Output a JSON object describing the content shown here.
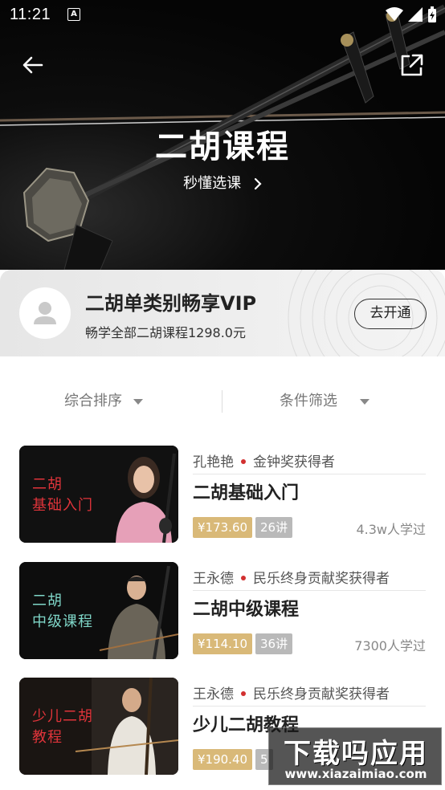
{
  "status_bar": {
    "time": "11:21",
    "a_icon": "A"
  },
  "hero": {
    "title": "二胡课程",
    "subtitle": "秒懂选课"
  },
  "vip": {
    "title": "二胡单类别畅享VIP",
    "description": "畅学全部二胡课程1298.0元",
    "button_label": "去开通"
  },
  "filters": {
    "sort_label": "综合排序",
    "filter_label": "条件筛选"
  },
  "courses": [
    {
      "thumb_text": "二胡\n基础入门",
      "thumb_color": "#e0343a",
      "teacher": "孔艳艳",
      "award": "金钟奖获得者",
      "title": "二胡基础入门",
      "price": "¥173.60",
      "lessons": "26讲",
      "learners": "4.3w人学过"
    },
    {
      "thumb_text": "二胡\n中级课程",
      "thumb_color": "#7fd6c8",
      "teacher": "王永德",
      "award": "民乐终身贡献奖获得者",
      "title": "二胡中级课程",
      "price": "¥114.10",
      "lessons": "36讲",
      "learners": "7300人学过"
    },
    {
      "thumb_text": "少儿二胡\n教程",
      "thumb_color": "#e0343a",
      "teacher": "王永德",
      "award": "民乐终身贡献奖获得者",
      "title": "少儿二胡教程",
      "price": "¥190.40",
      "lessons": "5",
      "learners": ""
    }
  ],
  "watermark": {
    "big": "下载吗应用",
    "small": "www.xiazaimiao.com"
  },
  "colors": {
    "price_tag": "#d9b978",
    "lesson_tag": "#b9b9b9",
    "dot": "#d23030"
  }
}
